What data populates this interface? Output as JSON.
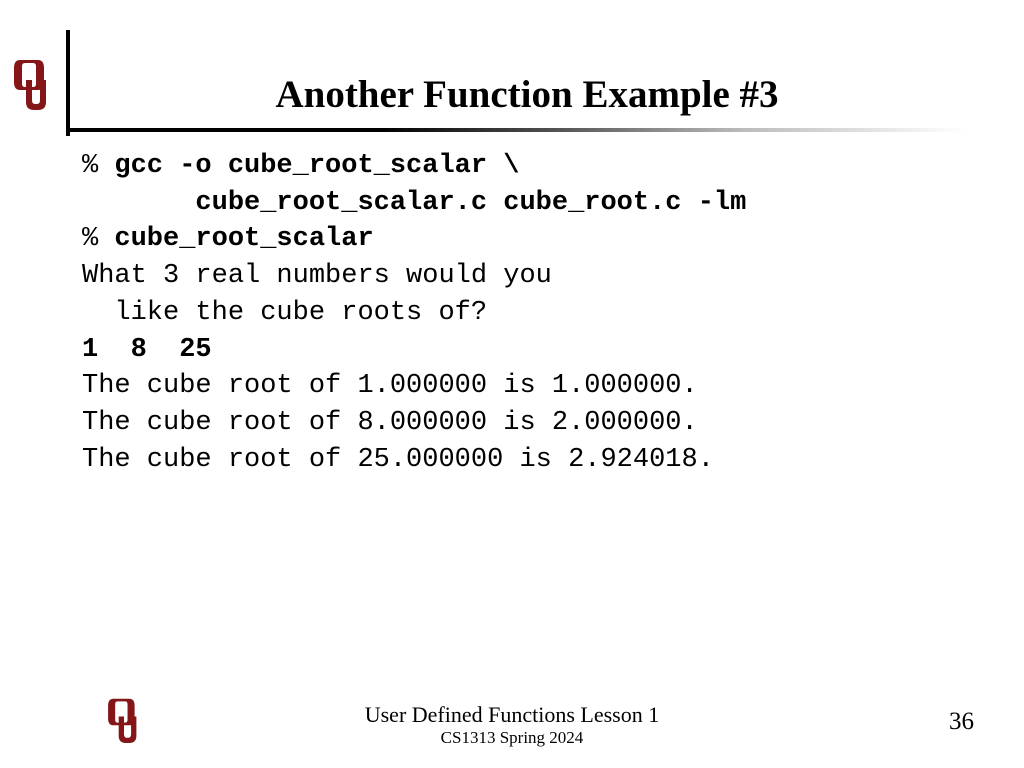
{
  "title": "Another Function Example #3",
  "terminal": {
    "l1_prompt": "% ",
    "l1_cmd": "gcc -o cube_root_scalar \\",
    "l2_cmd": "       cube_root_scalar.c cube_root.c -lm",
    "l3_prompt": "% ",
    "l3_cmd": "cube_root_scalar",
    "l4": "What 3 real numbers would you",
    "l5": "  like the cube roots of?",
    "l6_input": "1  8  25",
    "l7": "The cube root of 1.000000 is 1.000000.",
    "l8": "The cube root of 8.000000 is 2.000000.",
    "l9": "The cube root of 25.000000 is 2.924018."
  },
  "footer": {
    "lesson": "User Defined Functions Lesson 1",
    "course": "CS1313 Spring 2024"
  },
  "page_number": "36",
  "colors": {
    "crimson": "#841617"
  }
}
